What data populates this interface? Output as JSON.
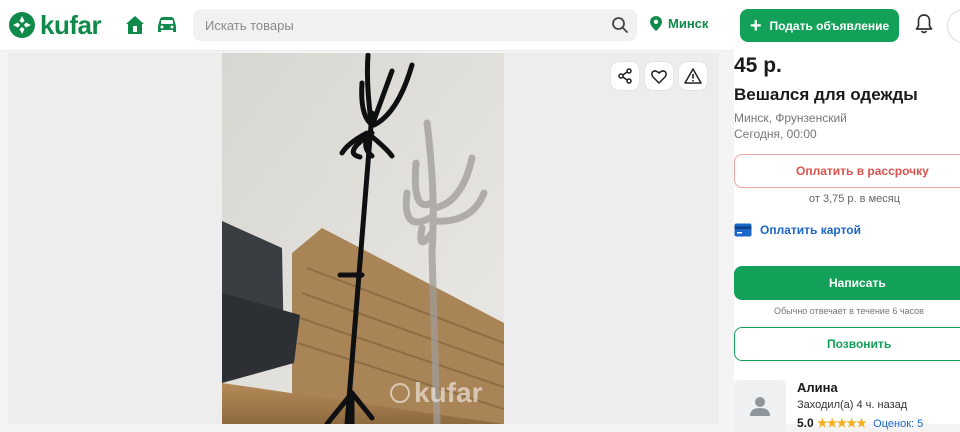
{
  "header": {
    "logo_text": "kufar",
    "search_placeholder": "Искать товары",
    "location": "Минск",
    "post_button": "Подать объявление"
  },
  "listing": {
    "price": "45 р.",
    "title": "Вешался для одежды",
    "location": "Минск, Фрунзенский",
    "date": "Сегодня, 00:00",
    "installment_button": "Оплатить в рассрочку",
    "installment_note": "от 3,75 р. в месяц",
    "pay_card": "Оплатить картой",
    "write_button": "Написать",
    "reply_note": "Обычно отвечает в течение 6 часов",
    "call_button": "Позвонить"
  },
  "seller": {
    "name": "Алина",
    "last_seen": "Заходил(а) 4 ч. назад",
    "rating": "5.0",
    "reviews": "Оценок: 5"
  },
  "photo": {
    "watermark": "kufar"
  },
  "colors": {
    "brand_green": "#13a058",
    "link_blue": "#1b66c9",
    "installment_red": "#d9534f"
  }
}
